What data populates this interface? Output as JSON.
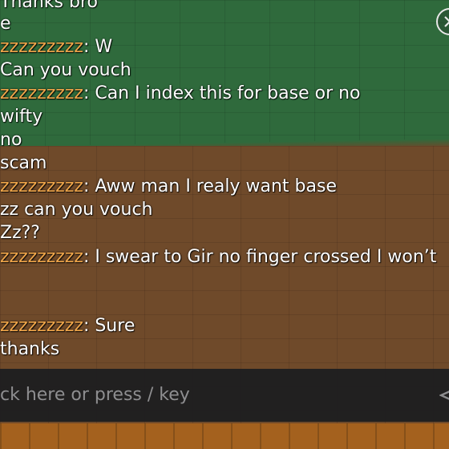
{
  "chat": {
    "lines": [
      {
        "name": "",
        "sep": "",
        "text": "Thanks bro"
      },
      {
        "name": "",
        "sep": "",
        "text": "e"
      },
      {
        "name": "zzzzzzzzz",
        "sep": ": ",
        "text": "W"
      },
      {
        "name": "",
        "sep": "",
        "text": "Can you vouch"
      },
      {
        "name": "zzzzzzzzz",
        "sep": ": ",
        "text": "Can I index this for base or no"
      },
      {
        "name": "",
        "sep": "",
        "text": "wifty"
      },
      {
        "name": "",
        "sep": "",
        "text": "no"
      },
      {
        "name": "",
        "sep": "",
        "text": "scam"
      },
      {
        "name": "zzzzzzzzz",
        "sep": ": ",
        "text": "Aww man I realy want base"
      },
      {
        "name": "",
        "sep": "",
        "text": "zz can you vouch"
      },
      {
        "name": "",
        "sep": "",
        "text": "Zz??"
      },
      {
        "name": "zzzzzzzzz",
        "sep": ": ",
        "text": "I swear to Gir no finger crossed I won’t"
      },
      {
        "name": "zzzzzzzzz",
        "sep": ": ",
        "text": "Sure"
      },
      {
        "name": "",
        "sep": "",
        "text": "thanks"
      }
    ],
    "name_color": "#f0a64a"
  },
  "input": {
    "placeholder": "ck here or press / key"
  },
  "icons": {
    "close": "close-icon",
    "send": "send-icon"
  }
}
